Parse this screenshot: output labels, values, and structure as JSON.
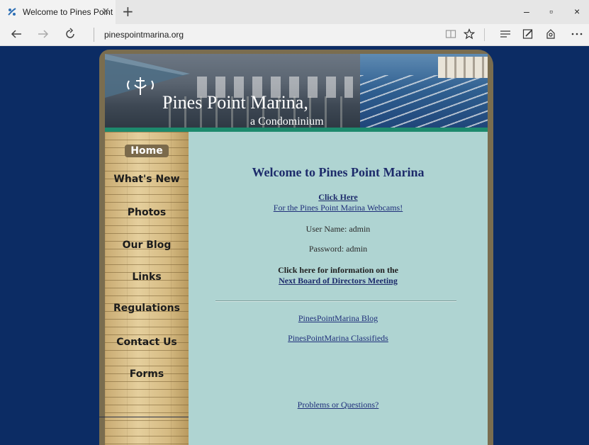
{
  "browser": {
    "tab_title": "Welcome to Pines Point",
    "tab_close": "×",
    "new_tab": "+",
    "url": "pinespointmarina.org",
    "window_controls": {
      "minimize": "–",
      "maximize": "▫",
      "close": "×"
    },
    "toolbar_icons": [
      "reading-view-icon",
      "favorite-star-icon",
      "hub-icon",
      "web-note-icon",
      "share-icon",
      "more-icon"
    ]
  },
  "site": {
    "title": "Pines Point Marina,",
    "subtitle": "a Condominium",
    "nav": [
      {
        "label": "Home",
        "active": true
      },
      {
        "label": "What's New",
        "active": false
      },
      {
        "label": "Photos",
        "active": false
      },
      {
        "label": "Our Blog",
        "active": false
      },
      {
        "label": "Links",
        "active": false
      },
      {
        "label": "Regulations",
        "active": false
      },
      {
        "label": "Contact Us",
        "active": false
      },
      {
        "label": "Forms",
        "active": false
      }
    ],
    "content": {
      "heading": "Welcome to Pines Point Marina",
      "click_here": "Click Here",
      "webcams_link": "For the Pines Point Marina Webcams!",
      "username": "User Name: admin",
      "password": "Password: admin",
      "board_info": "Click here for information on the",
      "board_link": "Next Board of Directors Meeting",
      "blog_link": "PinesPointMarina Blog",
      "classifieds_link": "PinesPointMarina Classifieds",
      "problems_link": "Problems or Questions?"
    }
  },
  "colors": {
    "page_bg": "#0c2c64",
    "content_bg": "#afd4d2",
    "link": "#1f2f7a",
    "accent_strip": "#1d8a6d"
  }
}
